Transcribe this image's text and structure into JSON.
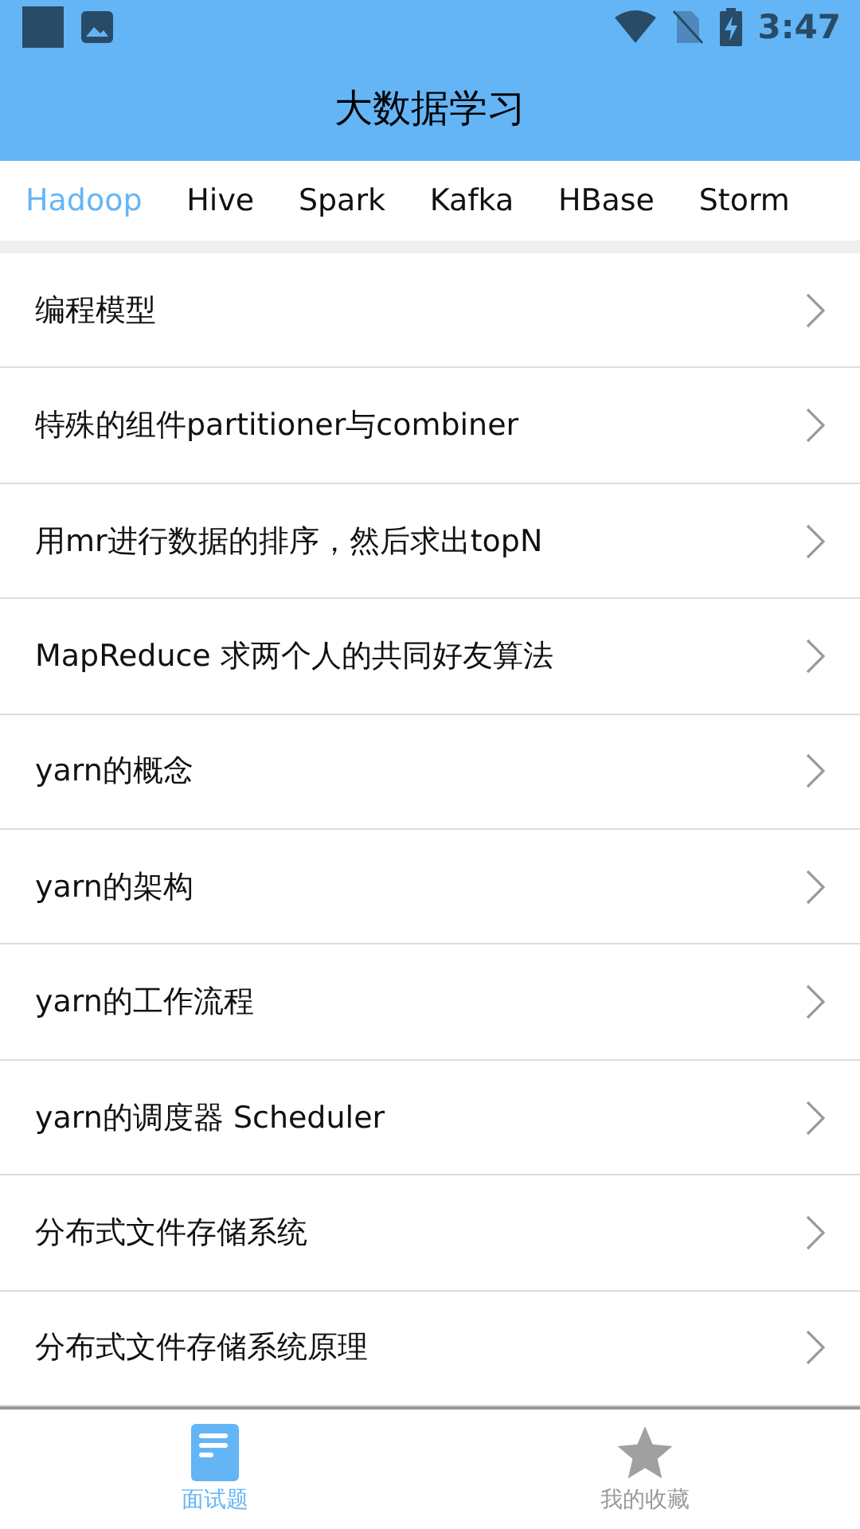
{
  "status_bar": {
    "time": "3:47"
  },
  "header": {
    "title": "大数据学习"
  },
  "tabs": [
    {
      "label": "Hadoop",
      "selected": true
    },
    {
      "label": "Hive",
      "selected": false
    },
    {
      "label": "Spark",
      "selected": false
    },
    {
      "label": "Kafka",
      "selected": false
    },
    {
      "label": "HBase",
      "selected": false
    },
    {
      "label": "Storm",
      "selected": false
    }
  ],
  "list": [
    {
      "title": "编程模型"
    },
    {
      "title": "特殊的组件partitioner与combiner"
    },
    {
      "title": "用mr进行数据的排序，然后求出topN"
    },
    {
      "title": "MapReduce 求两个人的共同好友算法"
    },
    {
      "title": "yarn的概念"
    },
    {
      "title": "yarn的架构"
    },
    {
      "title": "yarn的工作流程"
    },
    {
      "title": "yarn的调度器 Scheduler"
    },
    {
      "title": "分布式文件存储系统"
    },
    {
      "title": "分布式文件存储系统原理"
    }
  ],
  "bottom_nav": [
    {
      "label": "面试题",
      "kind": "doc",
      "selected": true
    },
    {
      "label": "我的收藏",
      "kind": "star",
      "selected": false
    }
  ]
}
